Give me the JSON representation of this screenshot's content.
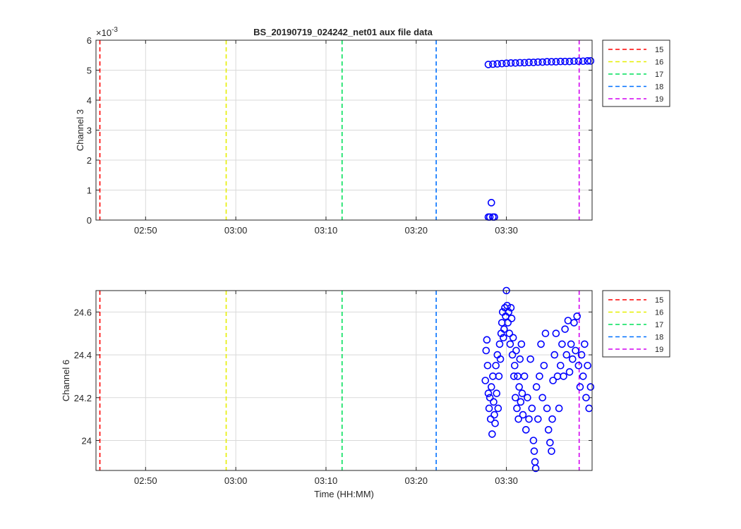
{
  "title": "BS_20190719_024242_net01 aux file data",
  "colors": {
    "marker": "#0000ff",
    "grid": "#d9d9d9",
    "axis": "#262626",
    "background": "#ffffff"
  },
  "chart_data": [
    {
      "type": "scatter",
      "title": "BS_20190719_024242_net01 aux file data",
      "xlabel": "",
      "ylabel": "Channel 3",
      "y_exponent_label": "×10",
      "y_exponent_power": "-3",
      "x_axis_type": "time",
      "xlim": [
        "02:44:30",
        "03:39:30"
      ],
      "ylim": [
        0,
        6
      ],
      "x_ticks": [
        "02:50",
        "03:00",
        "03:10",
        "03:20",
        "03:30"
      ],
      "y_ticks": [
        "0",
        "1",
        "2",
        "3",
        "4",
        "5",
        "6"
      ],
      "grid": true,
      "legend_position": "outside-right",
      "legend": [
        {
          "label": "15",
          "time": "02:44:56",
          "color": "#ff0000"
        },
        {
          "label": "16",
          "time": "02:58:56",
          "color": "#e6ef00"
        },
        {
          "label": "17",
          "time": "03:11:47",
          "color": "#00e05a"
        },
        {
          "label": "18",
          "time": "03:22:13",
          "color": "#0070ff"
        },
        {
          "label": "19",
          "time": "03:38:04",
          "color": "#d200f0"
        }
      ],
      "series": [
        {
          "marker": "circle",
          "color": "#0000ff",
          "points": [
            [
              "03:28:00",
              0.1
            ],
            [
              "03:28:10",
              0.1
            ],
            [
              "03:28:20",
              0.58
            ],
            [
              "03:28:30",
              0.1
            ],
            [
              "03:28:40",
              0.1
            ],
            [
              "03:28:00",
              5.19
            ],
            [
              "03:28:30",
              5.2
            ],
            [
              "03:29:00",
              5.21
            ],
            [
              "03:29:30",
              5.22
            ],
            [
              "03:30:00",
              5.23
            ],
            [
              "03:30:30",
              5.24
            ],
            [
              "03:31:00",
              5.24
            ],
            [
              "03:31:30",
              5.25
            ],
            [
              "03:32:00",
              5.25
            ],
            [
              "03:32:30",
              5.26
            ],
            [
              "03:33:00",
              5.26
            ],
            [
              "03:33:30",
              5.27
            ],
            [
              "03:34:00",
              5.27
            ],
            [
              "03:34:30",
              5.28
            ],
            [
              "03:35:00",
              5.28
            ],
            [
              "03:35:30",
              5.28
            ],
            [
              "03:36:00",
              5.29
            ],
            [
              "03:36:30",
              5.29
            ],
            [
              "03:37:00",
              5.29
            ],
            [
              "03:37:30",
              5.3
            ],
            [
              "03:38:00",
              5.3
            ],
            [
              "03:38:30",
              5.3
            ],
            [
              "03:39:00",
              5.31
            ],
            [
              "03:39:20",
              5.31
            ]
          ]
        }
      ]
    },
    {
      "type": "scatter",
      "xlabel": "Time (HH:MM)",
      "ylabel": "Channel 6",
      "x_axis_type": "time",
      "xlim": [
        "02:44:30",
        "03:39:30"
      ],
      "ylim": [
        23.86,
        24.7
      ],
      "x_ticks": [
        "02:50",
        "03:00",
        "03:10",
        "03:20",
        "03:30"
      ],
      "y_ticks": [
        "24",
        "24.2",
        "24.4",
        "24.6"
      ],
      "grid": true,
      "legend_position": "outside-right",
      "legend": [
        {
          "label": "15",
          "time": "02:44:56",
          "color": "#ff0000"
        },
        {
          "label": "16",
          "time": "02:58:56",
          "color": "#e6ef00"
        },
        {
          "label": "17",
          "time": "03:11:47",
          "color": "#00e05a"
        },
        {
          "label": "18",
          "time": "03:22:13",
          "color": "#0070ff"
        },
        {
          "label": "19",
          "time": "03:38:04",
          "color": "#d200f0"
        }
      ],
      "series": [
        {
          "marker": "circle",
          "color": "#0000ff",
          "points": [
            [
              "03:27:40",
              24.28
            ],
            [
              "03:27:45",
              24.42
            ],
            [
              "03:27:50",
              24.47
            ],
            [
              "03:27:55",
              24.35
            ],
            [
              "03:28:00",
              24.22
            ],
            [
              "03:28:05",
              24.15
            ],
            [
              "03:28:10",
              24.2
            ],
            [
              "03:28:15",
              24.1
            ],
            [
              "03:28:20",
              24.25
            ],
            [
              "03:28:25",
              24.03
            ],
            [
              "03:28:30",
              24.3
            ],
            [
              "03:28:35",
              24.18
            ],
            [
              "03:28:40",
              24.12
            ],
            [
              "03:28:45",
              24.08
            ],
            [
              "03:28:50",
              24.35
            ],
            [
              "03:28:55",
              24.22
            ],
            [
              "03:29:00",
              24.4
            ],
            [
              "03:29:05",
              24.15
            ],
            [
              "03:29:10",
              24.3
            ],
            [
              "03:29:15",
              24.45
            ],
            [
              "03:29:20",
              24.38
            ],
            [
              "03:29:25",
              24.5
            ],
            [
              "03:29:30",
              24.55
            ],
            [
              "03:29:35",
              24.6
            ],
            [
              "03:29:40",
              24.48
            ],
            [
              "03:29:45",
              24.52
            ],
            [
              "03:29:50",
              24.62
            ],
            [
              "03:29:55",
              24.58
            ],
            [
              "03:30:00",
              24.7
            ],
            [
              "03:30:05",
              24.63
            ],
            [
              "03:30:10",
              24.55
            ],
            [
              "03:30:15",
              24.6
            ],
            [
              "03:30:20",
              24.5
            ],
            [
              "03:30:25",
              24.45
            ],
            [
              "03:30:30",
              24.62
            ],
            [
              "03:30:35",
              24.57
            ],
            [
              "03:30:40",
              24.4
            ],
            [
              "03:30:45",
              24.48
            ],
            [
              "03:30:50",
              24.3
            ],
            [
              "03:30:55",
              24.35
            ],
            [
              "03:31:00",
              24.2
            ],
            [
              "03:31:05",
              24.42
            ],
            [
              "03:31:10",
              24.15
            ],
            [
              "03:31:15",
              24.3
            ],
            [
              "03:31:20",
              24.1
            ],
            [
              "03:31:25",
              24.25
            ],
            [
              "03:31:30",
              24.38
            ],
            [
              "03:31:35",
              24.18
            ],
            [
              "03:31:40",
              24.45
            ],
            [
              "03:31:45",
              24.22
            ],
            [
              "03:31:50",
              24.12
            ],
            [
              "03:32:00",
              24.3
            ],
            [
              "03:32:10",
              24.05
            ],
            [
              "03:32:20",
              24.2
            ],
            [
              "03:32:30",
              24.1
            ],
            [
              "03:32:40",
              24.38
            ],
            [
              "03:32:50",
              24.15
            ],
            [
              "03:33:00",
              24.0
            ],
            [
              "03:33:05",
              23.95
            ],
            [
              "03:33:10",
              23.9
            ],
            [
              "03:33:15",
              23.87
            ],
            [
              "03:33:20",
              24.25
            ],
            [
              "03:33:30",
              24.1
            ],
            [
              "03:33:40",
              24.3
            ],
            [
              "03:33:50",
              24.45
            ],
            [
              "03:34:00",
              24.2
            ],
            [
              "03:34:10",
              24.35
            ],
            [
              "03:34:20",
              24.5
            ],
            [
              "03:34:30",
              24.15
            ],
            [
              "03:34:40",
              24.05
            ],
            [
              "03:34:50",
              23.99
            ],
            [
              "03:35:00",
              23.95
            ],
            [
              "03:35:05",
              24.1
            ],
            [
              "03:35:10",
              24.28
            ],
            [
              "03:35:20",
              24.4
            ],
            [
              "03:35:30",
              24.5
            ],
            [
              "03:35:40",
              24.3
            ],
            [
              "03:35:50",
              24.15
            ],
            [
              "03:36:00",
              24.35
            ],
            [
              "03:36:10",
              24.45
            ],
            [
              "03:36:20",
              24.3
            ],
            [
              "03:36:30",
              24.52
            ],
            [
              "03:36:40",
              24.4
            ],
            [
              "03:36:50",
              24.56
            ],
            [
              "03:37:00",
              24.32
            ],
            [
              "03:37:10",
              24.45
            ],
            [
              "03:37:20",
              24.38
            ],
            [
              "03:37:30",
              24.55
            ],
            [
              "03:37:40",
              24.42
            ],
            [
              "03:37:50",
              24.58
            ],
            [
              "03:38:00",
              24.35
            ],
            [
              "03:38:10",
              24.25
            ],
            [
              "03:38:20",
              24.4
            ],
            [
              "03:38:30",
              24.3
            ],
            [
              "03:38:40",
              24.45
            ],
            [
              "03:38:50",
              24.2
            ],
            [
              "03:39:00",
              24.35
            ],
            [
              "03:39:10",
              24.15
            ],
            [
              "03:39:20",
              24.25
            ]
          ]
        }
      ]
    }
  ]
}
